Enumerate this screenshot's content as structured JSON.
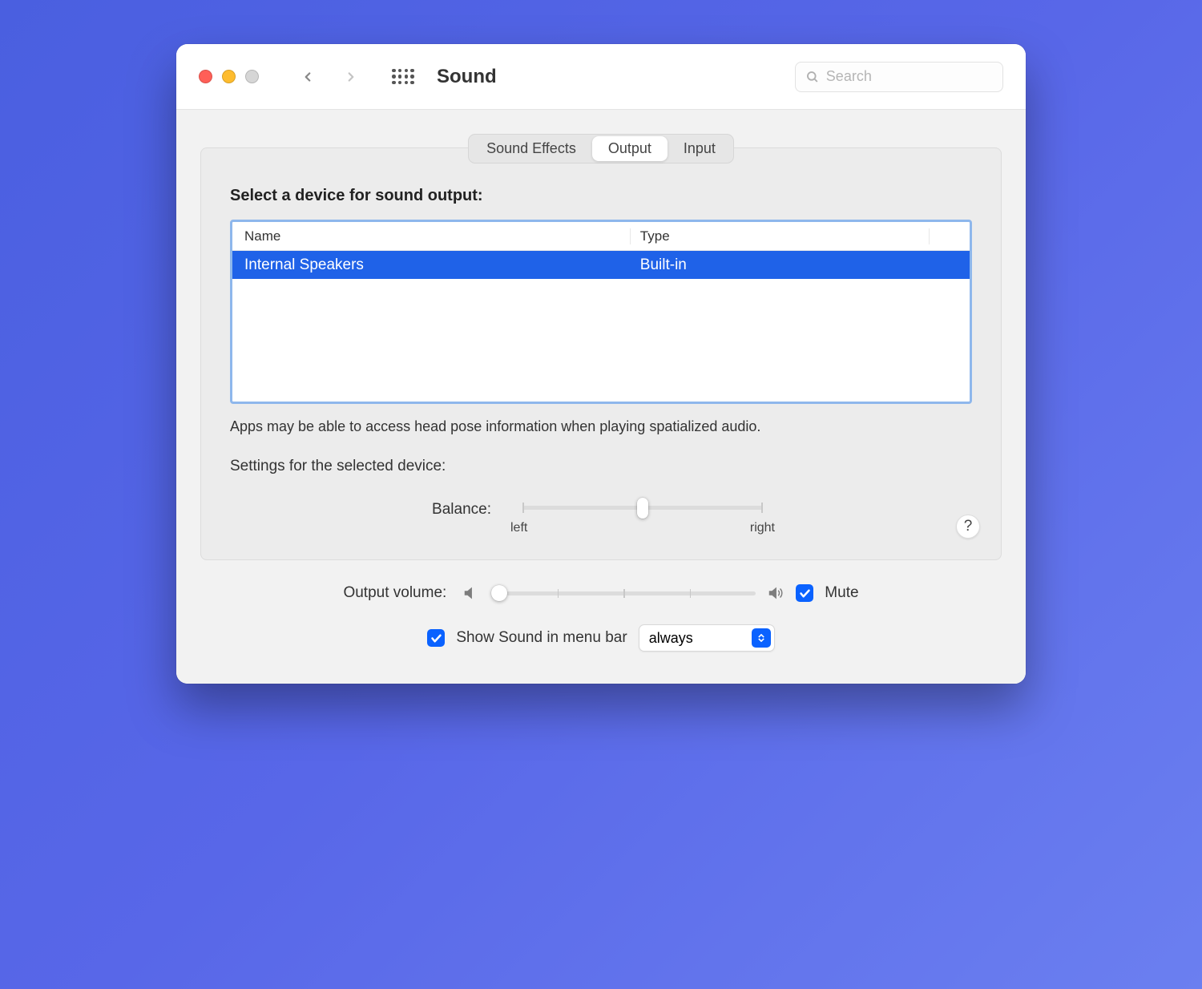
{
  "window": {
    "title": "Sound"
  },
  "search": {
    "placeholder": "Search"
  },
  "tabs": {
    "sound_effects": "Sound Effects",
    "output": "Output",
    "input": "Input"
  },
  "panel": {
    "heading": "Select a device for sound output:",
    "columns": {
      "name": "Name",
      "type": "Type"
    },
    "device": {
      "name": "Internal Speakers",
      "type": "Built-in"
    },
    "note": "Apps may be able to access head pose information when playing spatialized audio.",
    "settings_heading": "Settings for the selected device:",
    "balance_label": "Balance:",
    "balance_left": "left",
    "balance_right": "right"
  },
  "footer": {
    "volume_label": "Output volume:",
    "mute_label": "Mute",
    "menubar_label": "Show Sound in menu bar",
    "dropdown_value": "always"
  },
  "help": "?"
}
